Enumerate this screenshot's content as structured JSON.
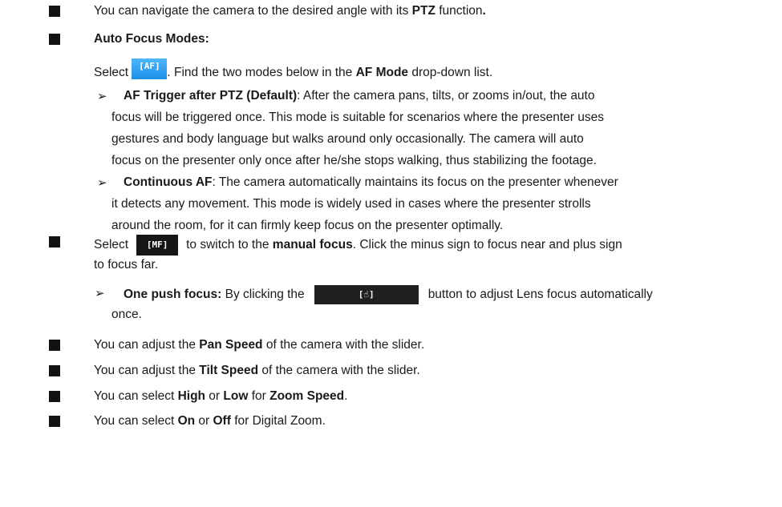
{
  "items": {
    "ptz": {
      "pre": "You can navigate the camera to the desired angle with its ",
      "bold": "PTZ",
      "post": " function",
      "end_bold": "."
    },
    "af_heading": "Auto Focus Modes:",
    "af_select": {
      "pre": "Select ",
      "icon_label": "[AF]",
      "mid": ". Find the two modes below in the ",
      "bold": "AF Mode",
      "post": " drop-down list."
    },
    "af_trigger": {
      "bold": "AF Trigger after PTZ (Default)",
      "line1": ": After the camera pans, tilts, or zooms in/out, the auto",
      "line2": "focus will be triggered once. This mode is suitable for scenarios where the presenter uses",
      "line3": "gestures and body language but walks around only occasionally. The camera will auto",
      "line4": "focus on the presenter only once after he/she stops walking, thus stabilizing the footage."
    },
    "continuous_af": {
      "bold": "Continuous AF",
      "line1": ": The camera automatically maintains its focus on the presenter whenever",
      "line2": "it detects any movement. This mode is widely used in cases where the presenter strolls",
      "line3": "around the room, for it can firmly keep focus on the presenter optimally."
    },
    "mf_select": {
      "pre": "Select",
      "icon_label": "[MF]",
      "mid": "to switch to the ",
      "bold": "manual focus",
      "post": ". Click the minus sign to focus near and plus sign",
      "line2": "to focus far."
    },
    "one_push": {
      "bold": "One push focus:",
      "pre": " By clicking the",
      "icon_label": "[☝]",
      "post": "button to adjust Lens focus automatically",
      "line2": "once."
    },
    "pan": {
      "pre": "You can adjust the ",
      "bold": "Pan Speed",
      "post": " of the camera with the slider."
    },
    "tilt": {
      "pre": "You can adjust the ",
      "bold": "Tilt Speed",
      "post": " of the camera with the slider."
    },
    "zoom": {
      "pre": "You can select ",
      "bold1": "High",
      "mid1": " or ",
      "bold2": "Low",
      "mid2": " for ",
      "bold3": "Zoom Speed",
      "post": "."
    },
    "digital": {
      "pre": "You can select ",
      "bold1": "On",
      "mid1": " or ",
      "bold2": "Off",
      "post": " for Digital Zoom."
    }
  },
  "bullet_square": "■",
  "bullet_arrow": "➢"
}
